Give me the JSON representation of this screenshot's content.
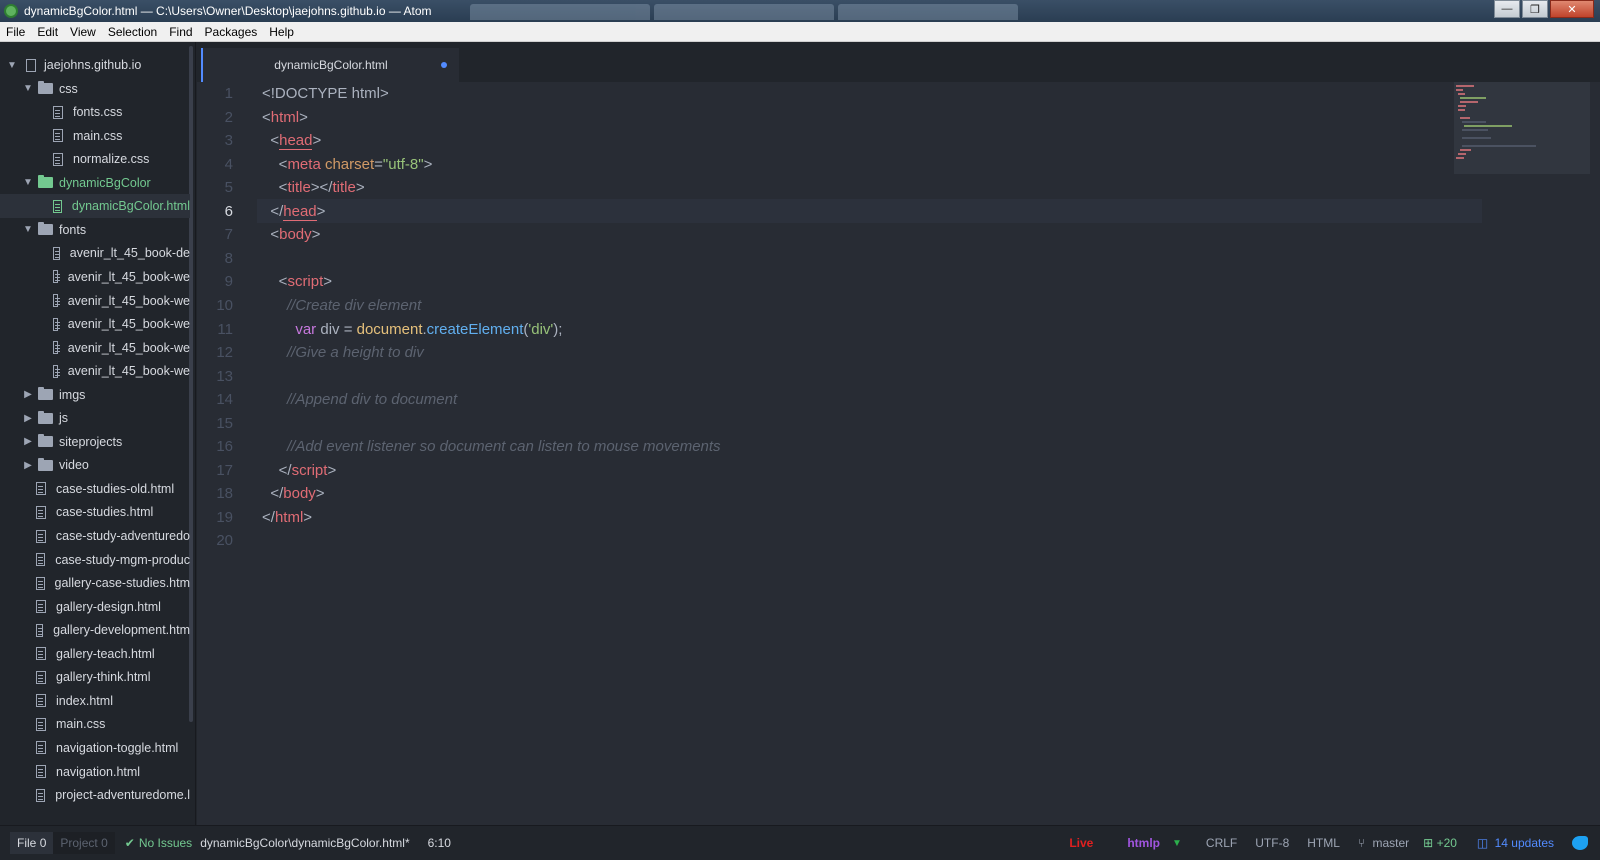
{
  "window": {
    "title": "dynamicBgColor.html — C:\\Users\\Owner\\Desktop\\jaejohns.github.io — Atom",
    "controls": {
      "minimize": "—",
      "maximize": "❐",
      "close": "✕"
    }
  },
  "menu": [
    "File",
    "Edit",
    "View",
    "Selection",
    "Find",
    "Packages",
    "Help"
  ],
  "tree": {
    "root": "jaejohns.github.io",
    "items": [
      {
        "label": "css",
        "type": "folder",
        "depth": 1,
        "expanded": true
      },
      {
        "label": "fonts.css",
        "type": "file",
        "depth": 2
      },
      {
        "label": "main.css",
        "type": "file",
        "depth": 2
      },
      {
        "label": "normalize.css",
        "type": "file",
        "depth": 2
      },
      {
        "label": "dynamicBgColor",
        "type": "folder",
        "depth": 1,
        "expanded": true,
        "status": "added"
      },
      {
        "label": "dynamicBgColor.html",
        "type": "file",
        "depth": 2,
        "status": "added",
        "selected": true
      },
      {
        "label": "fonts",
        "type": "folder",
        "depth": 1,
        "expanded": true
      },
      {
        "label": "avenir_lt_45_book-de",
        "type": "file",
        "depth": 2
      },
      {
        "label": "avenir_lt_45_book-we",
        "type": "file",
        "depth": 2
      },
      {
        "label": "avenir_lt_45_book-we",
        "type": "file",
        "depth": 2
      },
      {
        "label": "avenir_lt_45_book-we",
        "type": "file",
        "depth": 2
      },
      {
        "label": "avenir_lt_45_book-we",
        "type": "file",
        "depth": 2
      },
      {
        "label": "avenir_lt_45_book-we",
        "type": "file",
        "depth": 2
      },
      {
        "label": "imgs",
        "type": "folder",
        "depth": 1,
        "expanded": false
      },
      {
        "label": "js",
        "type": "folder",
        "depth": 1,
        "expanded": false
      },
      {
        "label": "siteprojects",
        "type": "folder",
        "depth": 1,
        "expanded": false
      },
      {
        "label": "video",
        "type": "folder",
        "depth": 1,
        "expanded": false
      },
      {
        "label": "case-studies-old.html",
        "type": "file",
        "depth": 1
      },
      {
        "label": "case-studies.html",
        "type": "file",
        "depth": 1
      },
      {
        "label": "case-study-adventuredo",
        "type": "file",
        "depth": 1
      },
      {
        "label": "case-study-mgm-produc",
        "type": "file",
        "depth": 1
      },
      {
        "label": "gallery-case-studies.htm",
        "type": "file",
        "depth": 1
      },
      {
        "label": "gallery-design.html",
        "type": "file",
        "depth": 1
      },
      {
        "label": "gallery-development.htm",
        "type": "file",
        "depth": 1
      },
      {
        "label": "gallery-teach.html",
        "type": "file",
        "depth": 1
      },
      {
        "label": "gallery-think.html",
        "type": "file",
        "depth": 1
      },
      {
        "label": "index.html",
        "type": "file",
        "depth": 1
      },
      {
        "label": "main.css",
        "type": "file",
        "depth": 1
      },
      {
        "label": "navigation-toggle.html",
        "type": "file",
        "depth": 1
      },
      {
        "label": "navigation.html",
        "type": "file",
        "depth": 1
      },
      {
        "label": "project-adventuredome.l",
        "type": "file",
        "depth": 1
      }
    ]
  },
  "tab": {
    "label": "dynamicBgColor.html",
    "modified": true
  },
  "editor": {
    "current_line": 6,
    "lines": [
      [
        {
          "t": "<!DOCTYPE html>",
          "c": "punct"
        }
      ],
      [
        {
          "t": "<",
          "c": "punct"
        },
        {
          "t": "html",
          "c": "tag"
        },
        {
          "t": ">",
          "c": "punct"
        }
      ],
      [
        {
          "t": "  <",
          "c": "punct"
        },
        {
          "t": "head",
          "c": "tag",
          "u": true
        },
        {
          "t": ">",
          "c": "punct"
        }
      ],
      [
        {
          "t": "    <",
          "c": "punct"
        },
        {
          "t": "meta",
          "c": "tag"
        },
        {
          "t": " charset",
          "c": "attr"
        },
        {
          "t": "=",
          "c": "punct"
        },
        {
          "t": "\"utf-8\"",
          "c": "str"
        },
        {
          "t": ">",
          "c": "punct"
        }
      ],
      [
        {
          "t": "    <",
          "c": "punct"
        },
        {
          "t": "title",
          "c": "tag"
        },
        {
          "t": "></",
          "c": "punct"
        },
        {
          "t": "title",
          "c": "tag"
        },
        {
          "t": ">",
          "c": "punct"
        }
      ],
      [
        {
          "t": "  </",
          "c": "punct"
        },
        {
          "t": "head",
          "c": "tag",
          "u": true
        },
        {
          "t": ">",
          "c": "punct"
        }
      ],
      [
        {
          "t": "  <",
          "c": "punct"
        },
        {
          "t": "body",
          "c": "tag"
        },
        {
          "t": ">",
          "c": "punct"
        }
      ],
      [],
      [
        {
          "t": "    <",
          "c": "punct"
        },
        {
          "t": "script",
          "c": "tag"
        },
        {
          "t": ">",
          "c": "punct"
        }
      ],
      [
        {
          "t": "      //Create div element",
          "c": "cmt"
        }
      ],
      [
        {
          "t": "        ",
          "c": "punct"
        },
        {
          "t": "var",
          "c": "kw"
        },
        {
          "t": " div = ",
          "c": "punct"
        },
        {
          "t": "document",
          "c": "obj"
        },
        {
          "t": ".",
          "c": "punct"
        },
        {
          "t": "createElement",
          "c": "fn"
        },
        {
          "t": "(",
          "c": "punct"
        },
        {
          "t": "'div'",
          "c": "str"
        },
        {
          "t": ");",
          "c": "punct"
        }
      ],
      [
        {
          "t": "      //Give a height to div",
          "c": "cmt"
        }
      ],
      [],
      [
        {
          "t": "      //Append div to document",
          "c": "cmt"
        }
      ],
      [],
      [
        {
          "t": "      //Add event listener so document can listen to mouse movements",
          "c": "cmt"
        }
      ],
      [
        {
          "t": "    </",
          "c": "punct"
        },
        {
          "t": "script",
          "c": "tag"
        },
        {
          "t": ">",
          "c": "punct"
        }
      ],
      [
        {
          "t": "  </",
          "c": "punct"
        },
        {
          "t": "body",
          "c": "tag"
        },
        {
          "t": ">",
          "c": "punct"
        }
      ],
      [
        {
          "t": "</",
          "c": "punct"
        },
        {
          "t": "html",
          "c": "tag"
        },
        {
          "t": ">",
          "c": "punct"
        }
      ],
      []
    ]
  },
  "status": {
    "file_tab": "File",
    "file_count": "0",
    "project_tab": "Project",
    "project_count": "0",
    "linter": "No Issues",
    "path": "dynamicBgColor\\dynamicBgColor.html*",
    "cursor": "6:10",
    "live": "Live",
    "htmlp": "htmlp",
    "line_ending": "CRLF",
    "encoding": "UTF-8",
    "grammar": "HTML",
    "branch": "master",
    "git_added": "+20",
    "updates": "14 updates"
  }
}
